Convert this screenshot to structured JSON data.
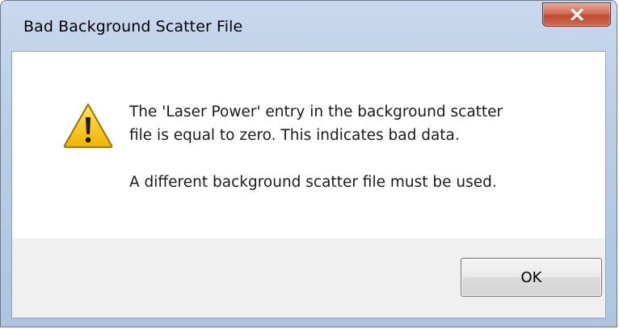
{
  "window": {
    "title": "Bad Background Scatter File"
  },
  "icons": {
    "close": "close-icon",
    "warning": "warning-icon"
  },
  "message": {
    "line1": "The 'Laser Power' entry in the background scatter",
    "line2": "file is equal to zero.  This indicates bad data.",
    "line3": "A different background scatter file must be used."
  },
  "buttons": {
    "ok_label": "OK"
  },
  "colors": {
    "titlebar": "#b9cde6",
    "close_button": "#c14a33",
    "content_background": "#ffffff",
    "button_area": "#f0f0f0",
    "warning_yellow": "#f5c400"
  }
}
